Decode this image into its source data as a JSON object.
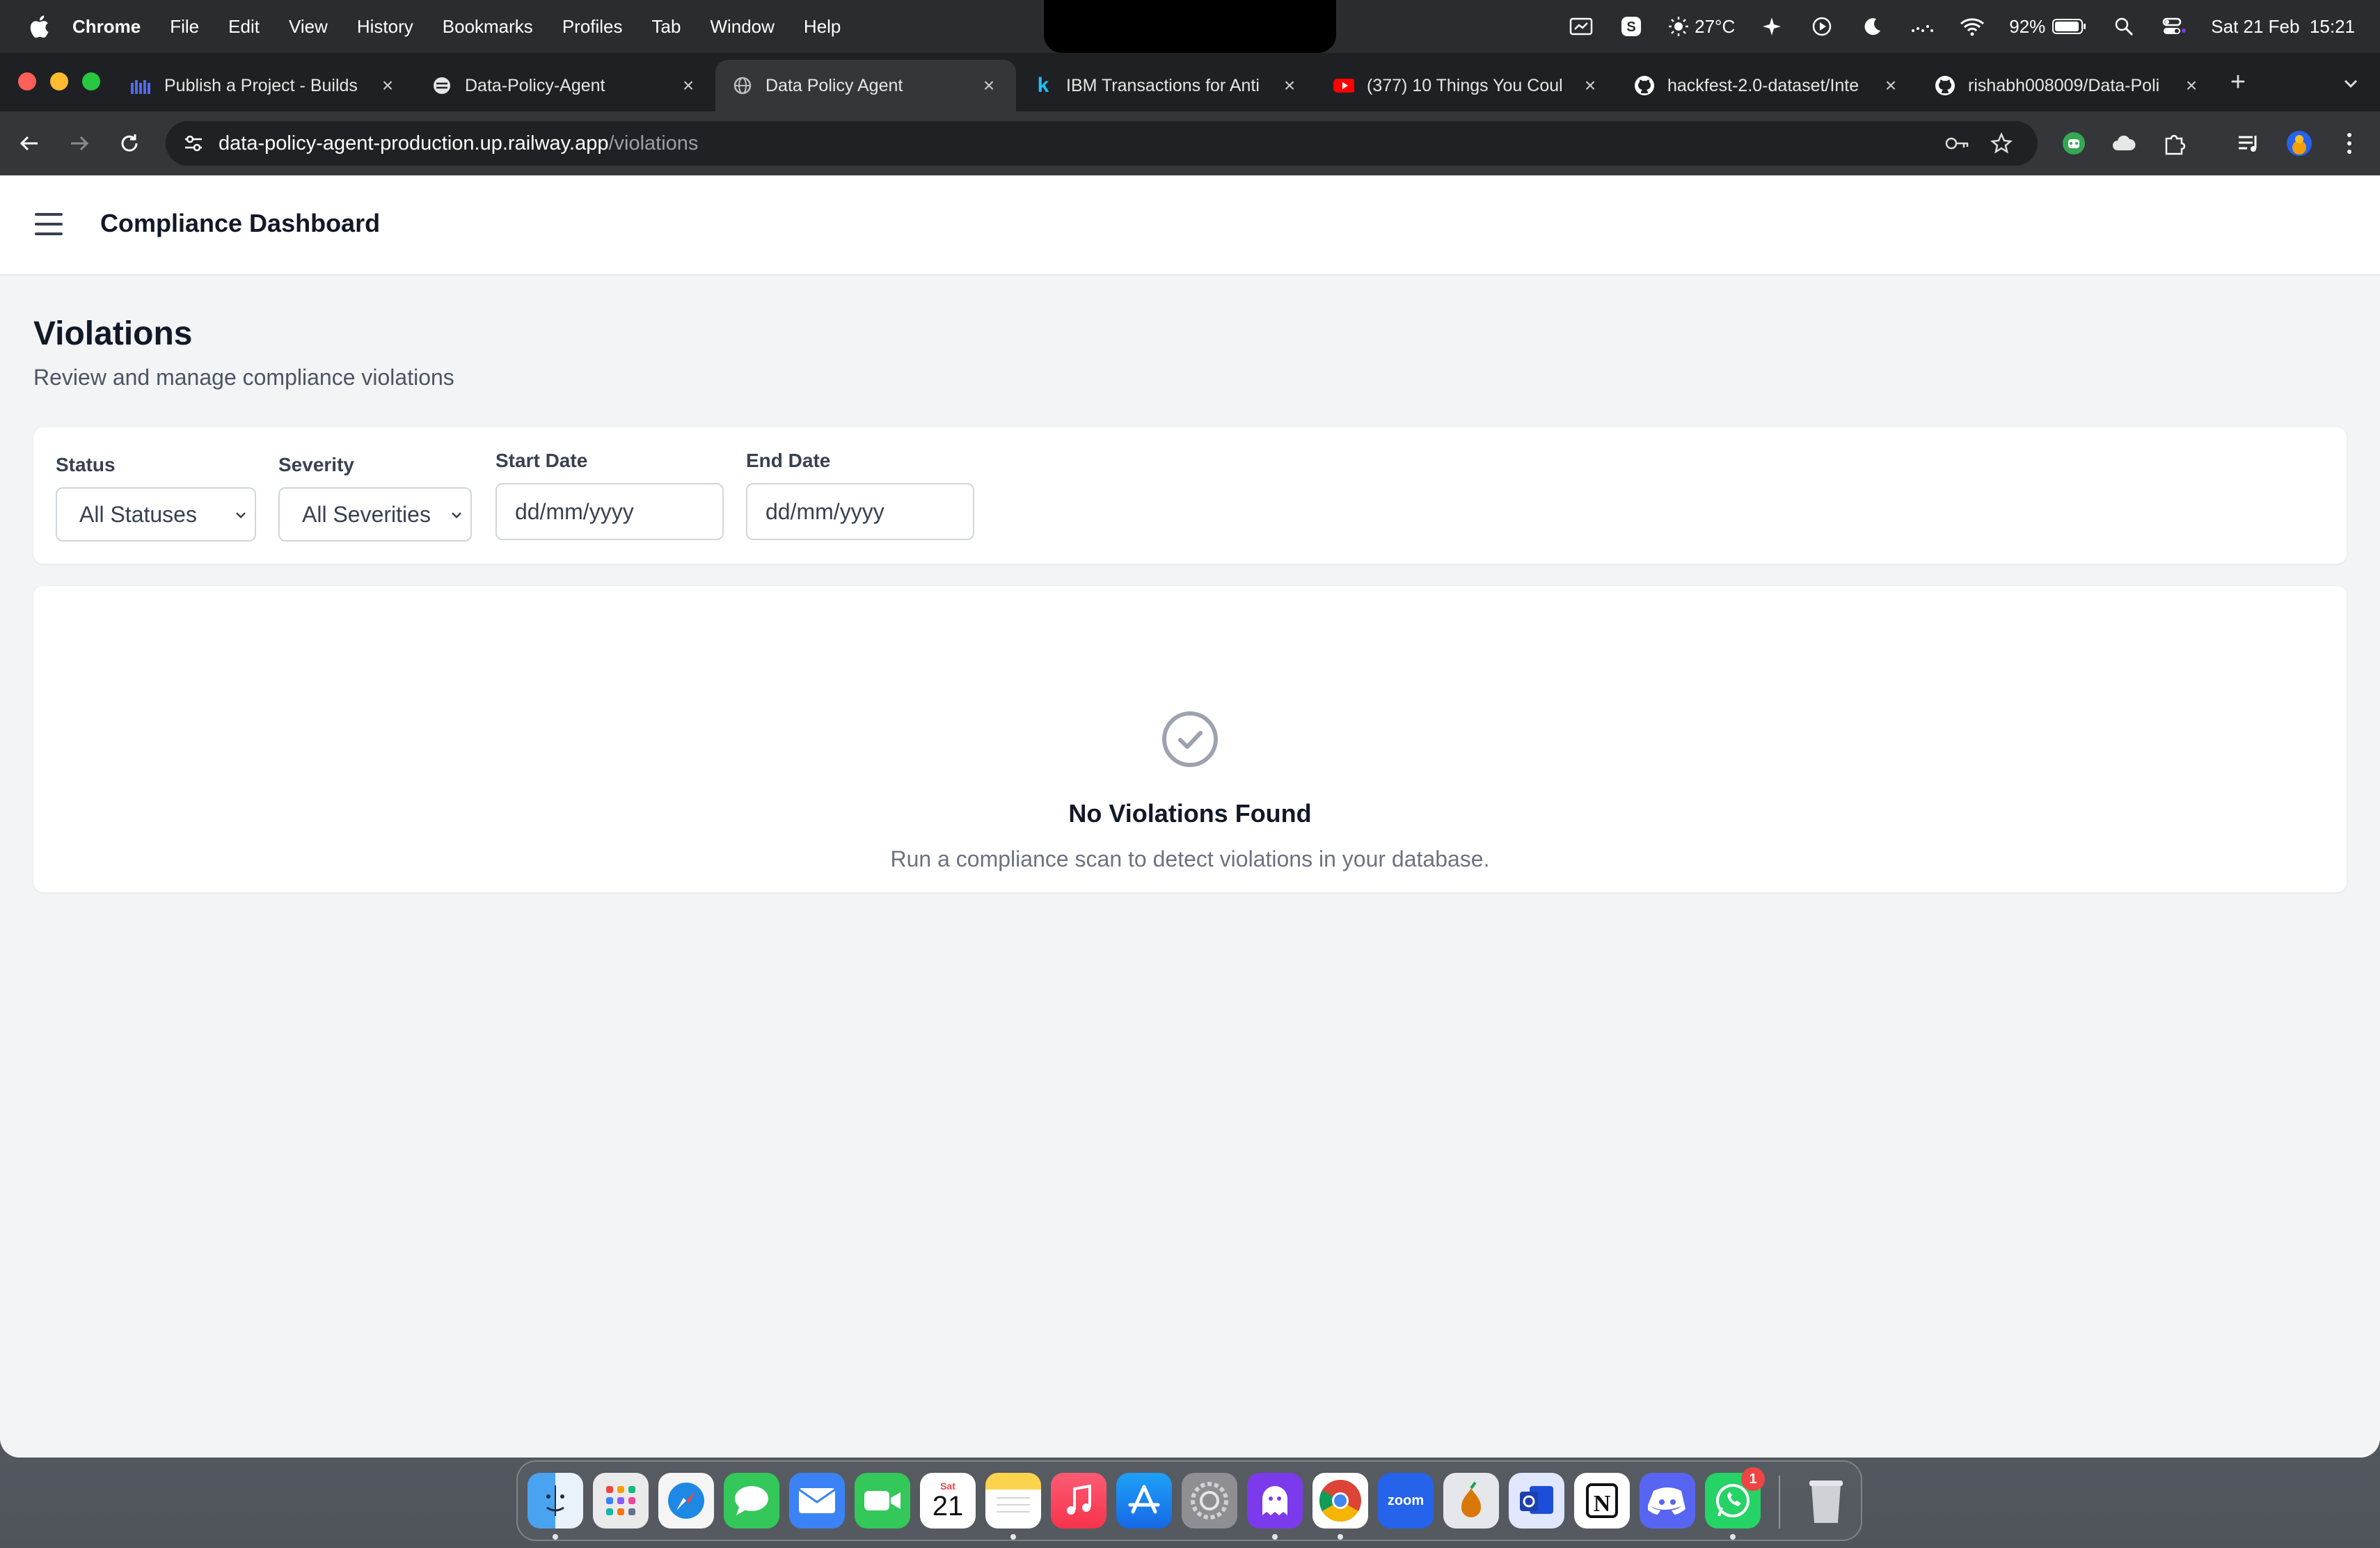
{
  "menubar": {
    "app": "Chrome",
    "items": [
      "File",
      "Edit",
      "View",
      "History",
      "Bookmarks",
      "Profiles",
      "Tab",
      "Window",
      "Help"
    ],
    "weather": "27°C",
    "battery": "92%",
    "datetime": "Sat 21 Feb  15:21"
  },
  "tabs": [
    {
      "title": "Publish a Project - Builds",
      "favicon": "builds-icon"
    },
    {
      "title": "Data-Policy-Agent",
      "favicon": "globe-icon"
    },
    {
      "title": "Data Policy Agent",
      "favicon": "globe-icon"
    },
    {
      "title": "IBM Transactions for Anti",
      "favicon": "kaggle-icon"
    },
    {
      "title": "(377) 10 Things You Coul",
      "favicon": "youtube-icon"
    },
    {
      "title": "hackfest-2.0-dataset/Inte",
      "favicon": "github-icon"
    },
    {
      "title": "rishabh008009/Data-Poli",
      "favicon": "github-icon"
    }
  ],
  "address": {
    "host": "data-policy-agent-production.up.railway.app",
    "path": "/violations"
  },
  "app": {
    "title": "Compliance Dashboard"
  },
  "page": {
    "heading": "Violations",
    "subheading": "Review and manage compliance violations"
  },
  "filters": {
    "status_label": "Status",
    "status_value": "All Statuses",
    "severity_label": "Severity",
    "severity_value": "All Severities",
    "start_label": "Start Date",
    "start_placeholder": "dd/mm/yyyy",
    "end_label": "End Date",
    "end_placeholder": "dd/mm/yyyy"
  },
  "empty_state": {
    "title": "No Violations Found",
    "text": "Run a compliance scan to detect violations in your database."
  },
  "dock": {
    "calendar_day": "Sat",
    "calendar_date": "21",
    "whatsapp_badge": "1",
    "zoom_label": "zoom"
  },
  "colors": {
    "accent": "#111827",
    "page_bg": "#f3f4f6",
    "muted_text": "#6b7280"
  }
}
